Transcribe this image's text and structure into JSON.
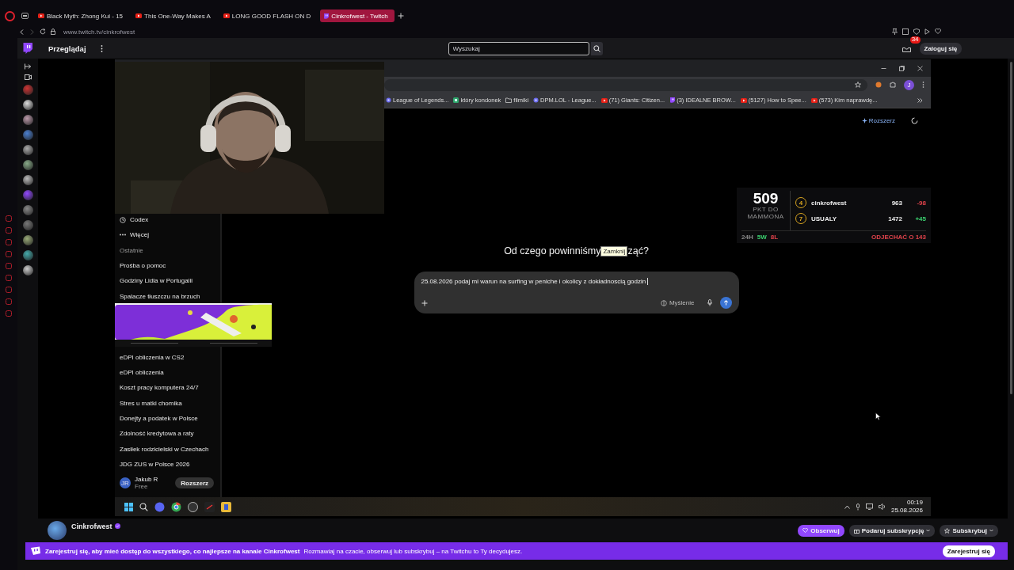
{
  "browser": {
    "tabs": [
      {
        "title": "Black Myth: Zhong Kui - 15",
        "kind": "youtube",
        "selected": false
      },
      {
        "title": "This One-Way Makes A",
        "kind": "youtube",
        "selected": false
      },
      {
        "title": "LONG GOOD FLASH ON D",
        "kind": "youtube",
        "selected": false
      },
      {
        "title": "Cinkrofwest - Twitch",
        "kind": "twitch",
        "selected": true
      }
    ],
    "url": "www.twitch.tv/cinkrofwest"
  },
  "twitch_nav": {
    "browse": "Przeglądaj",
    "search": {
      "placeholder": "Wyszukaj"
    },
    "inbox_badge": "34",
    "login": "Zaloguj się"
  },
  "stream": {
    "chrome": {
      "profile_initial": "J",
      "bookmarks": [
        {
          "label": "League of Legends...",
          "kind": "page"
        },
        {
          "label": "który kondonek",
          "kind": "app"
        },
        {
          "label": "filmiki",
          "kind": "folder"
        },
        {
          "label": "DPM.LOL - League...",
          "kind": "page"
        },
        {
          "label": "(71) Giants: Citizen...",
          "kind": "youtube"
        },
        {
          "label": "(3) IDEALNE BROW...",
          "kind": "twitch"
        },
        {
          "label": "(5127) How to Spee...",
          "kind": "youtube"
        },
        {
          "label": "(573) Kim naprawdę...",
          "kind": "youtube"
        }
      ],
      "extend": "Rozszerz"
    },
    "chat_sidebar": {
      "nav": [
        {
          "label": "Codex",
          "kind": "codex"
        },
        {
          "label": "Więcej",
          "kind": "more"
        }
      ],
      "section": "Ostatnie",
      "chats_top": [
        "Prośba o pomoc",
        "Godziny Lidla w Portugalii",
        "Spalacze tłuszczu na brzuch"
      ],
      "chats_bottom": [
        "eDPI obliczenia w CS2",
        "eDPI obliczenia",
        "Koszt pracy komputera 24/7",
        "Stres u matki chomika",
        "Donejty a podatek w Polsce",
        "Zdolność kredytowa a raty",
        "Zasiłek rodzicielski w Czechach",
        "JDG ZUS w Polsce 2026"
      ],
      "user": {
        "initials": "JR",
        "name": "Jakub R",
        "plan": "Free",
        "upgrade": "Rozszerz"
      }
    },
    "prompt": {
      "heading_start": "Od czego powinniśmy",
      "tooltip": "Zamknij",
      "heading_end": "ząć?",
      "value": "25.08.2026 podaj mi warun na surfing w peniche i okolicy z dokładnoscią godzin",
      "thinking": "Myślenie"
    },
    "scoreboard": {
      "points": "509",
      "points_label_1": "PKT DO",
      "points_label_2": "MAMMONA",
      "players": [
        {
          "rank": "4",
          "name": "cinkrofwest",
          "score": "963",
          "delta": "-98",
          "kind": "down"
        },
        {
          "rank": "7",
          "name": "USUALY",
          "score": "1472",
          "delta": "+45",
          "kind": "up"
        }
      ],
      "period": "24H",
      "wins": "5W",
      "losses": "8L",
      "gap": "ODJECHAĆ O 143"
    },
    "taskbar": {
      "time": "00:19",
      "date": "25.08.2026"
    }
  },
  "channel": {
    "name": "Cinkrofwest",
    "follow": "Obserwuj",
    "gift": "Podaruj subskrypcję",
    "subscribe": "Subskrybuj"
  },
  "banner": {
    "headline": "Zarejestruj się, aby mieć dostęp do wszystkiego, co najlepsze na kanale Cinkrofwest",
    "text": "Rozmawiaj na czacie, obserwuj lub subskrybuj – na Twitchu to Ty decydujesz.",
    "signup": "Zarejestruj się"
  }
}
